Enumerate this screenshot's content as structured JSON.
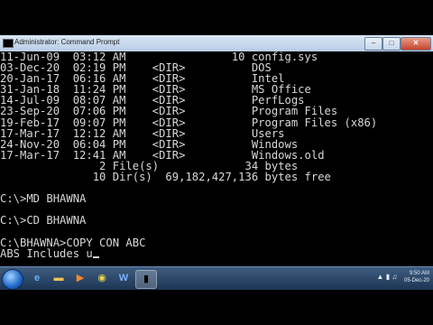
{
  "window": {
    "title": "Administrator: Command Prompt",
    "min_label": "–",
    "max_label": "□",
    "close_label": "✕"
  },
  "console": {
    "lines": [
      "11-Jun-09  03:12 AM                10 config.sys",
      "03-Dec-20  02:19 PM    <DIR>          DOS",
      "20-Jan-17  06:16 AM    <DIR>          Intel",
      "31-Jan-18  11:24 PM    <DIR>          MS Office",
      "14-Jul-09  08:07 AM    <DIR>          PerfLogs",
      "23-Sep-20  07:06 PM    <DIR>          Program Files",
      "19-Feb-17  09:07 PM    <DIR>          Program Files (x86)",
      "17-Mar-17  12:12 AM    <DIR>          Users",
      "24-Nov-20  06:04 PM    <DIR>          Windows",
      "17-Mar-17  12:41 AM    <DIR>          Windows.old",
      "               2 File(s)             34 bytes",
      "              10 Dir(s)  69,182,427,136 bytes free",
      "",
      "C:\\>MD BHAWNA",
      "",
      "C:\\>CD BHAWNA",
      "",
      "C:\\BHAWNA>COPY CON ABC",
      "ABS Includes u"
    ]
  },
  "taskbar": {
    "icons": [
      {
        "name": "ie-icon",
        "glyph": "e"
      },
      {
        "name": "folder-icon",
        "glyph": "▬"
      },
      {
        "name": "media-player-icon",
        "glyph": "▶"
      },
      {
        "name": "chrome-icon",
        "glyph": "◉"
      },
      {
        "name": "word-icon",
        "glyph": "W"
      },
      {
        "name": "cmd-icon",
        "glyph": "▮"
      }
    ],
    "clock_time": "9:50 AM",
    "clock_date": "05-Dec-20"
  }
}
